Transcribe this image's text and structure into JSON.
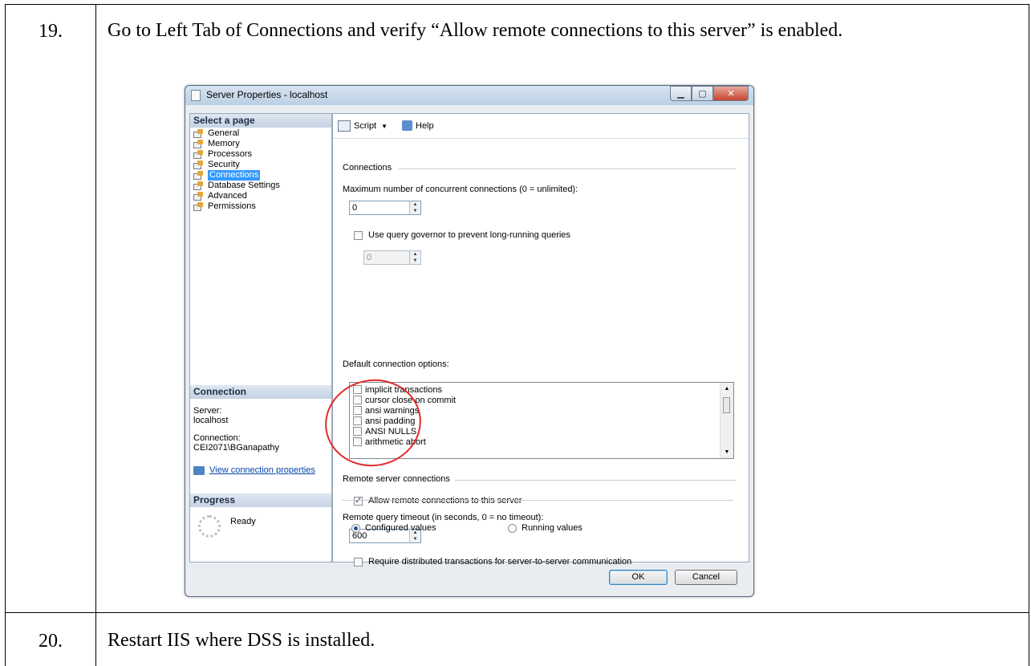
{
  "steps": [
    {
      "number": "19.",
      "text": "Go to Left Tab of Connections and verify “Allow remote connections to this server” is enabled."
    },
    {
      "number": "20.",
      "text": "Restart IIS where DSS is installed."
    }
  ],
  "dialog": {
    "title": "Server Properties - localhost",
    "select_page_header": "Select a page",
    "pages": [
      "General",
      "Memory",
      "Processors",
      "Security",
      "Connections",
      "Database Settings",
      "Advanced",
      "Permissions"
    ],
    "selected_page": "Connections",
    "connection_header": "Connection",
    "server_label": "Server:",
    "server_value": "localhost",
    "connection_label": "Connection:",
    "connection_value": "CEI2071\\BGanapathy",
    "view_connection_link": "View connection properties",
    "progress_header": "Progress",
    "progress_status": "Ready",
    "toolbar": {
      "script_label": "Script",
      "help_label": "Help"
    },
    "connections_group": "Connections",
    "max_connections_label": "Maximum number of concurrent connections (0 = unlimited):",
    "max_connections_value": "0",
    "query_governor_label": "Use query governor to prevent long-running queries",
    "query_governor_value": "0",
    "default_options_label": "Default connection options:",
    "default_options": [
      "implicit transactions",
      "cursor close on commit",
      "ansi warnings",
      "ansi padding",
      "ANSI NULLS",
      "arithmetic abort"
    ],
    "remote_group": "Remote server connections",
    "allow_remote_label": "Allow remote connections to this server",
    "allow_remote_checked": true,
    "remote_timeout_label": "Remote query timeout (in seconds, 0 = no timeout):",
    "remote_timeout_value": "600",
    "require_distributed_label": "Require distributed transactions for server-to-server communication",
    "configured_values_label": "Configured values",
    "running_values_label": "Running values",
    "ok_label": "OK",
    "cancel_label": "Cancel"
  },
  "colors": {
    "annotation_circle": "#e22a2a",
    "selected_page": "#3399ff"
  }
}
